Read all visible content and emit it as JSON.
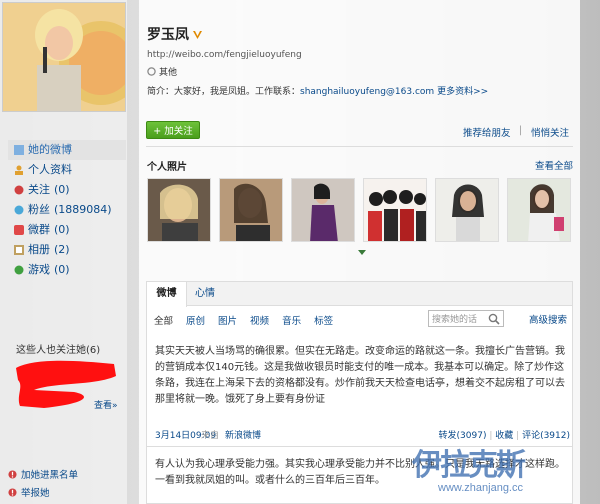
{
  "colors": {
    "link": "#0a4a8a",
    "follow_green": "#4a9e1c",
    "accent_orange": "#e08a00"
  },
  "sidebar": {
    "items": [
      {
        "label": "她的微博",
        "count": "",
        "icon": "home-icon",
        "active": true
      },
      {
        "label": "个人资料",
        "count": "",
        "icon": "profile-icon",
        "active": false
      },
      {
        "label": "关注",
        "count": "(0)",
        "icon": "follow-icon",
        "active": false
      },
      {
        "label": "粉丝",
        "count": "(1889084)",
        "icon": "fans-icon",
        "active": false
      },
      {
        "label": "微群",
        "count": "(0)",
        "icon": "group-icon",
        "active": false
      },
      {
        "label": "相册",
        "count": "(2)",
        "icon": "album-icon",
        "active": false
      },
      {
        "label": "游戏",
        "count": "(0)",
        "icon": "game-icon",
        "active": false
      }
    ],
    "also_follow_title": "这些人也关注她(6)",
    "see_all": "查看»",
    "blacklist": "加她进黑名单",
    "report": "举报她"
  },
  "profile": {
    "name": "罗玉凤",
    "url": "http://weibo.com/fengjieluoyufeng",
    "gender": "其他",
    "intro_prefix": "简介：大家好，我是凤姐。工作联系：",
    "email": "shanghailuoyufeng@163.com",
    "more": "更多资料>>",
    "follow_button": "+ 加关注",
    "rec_friends": "推荐给朋友",
    "separator": "|",
    "rec_follow": "悄悄关注"
  },
  "photos": {
    "title": "个人照片",
    "see_all": "查看全部"
  },
  "feed": {
    "tabs": [
      "微博",
      "心情"
    ],
    "filters": [
      "全部",
      "原创",
      "图片",
      "视频",
      "音乐",
      "标签"
    ],
    "search_placeholder": "搜索她的话",
    "advanced_search": "高级搜索",
    "post1_text": "其实天天被人当场骂的确很累。但实在无路走。改变命运的路就这一条。我擅长广告营销。我的营销成本仅140元钱。这是我做收银员时能支付的唯一成本。我基本可以确定。除了炒作这条路，我连在上海呆下去的资格都没有。炒作前我天天检查电话亭，想着交不起房租了可以去那里将就一晚。饿死了身上要有身份证",
    "post1_time": "3月14日09:09",
    "post1_from": "来自",
    "post1_via": "新浪微博",
    "post1_actions": [
      "转发(3097)",
      "收藏",
      "评论(3912)"
    ],
    "post2_text": "有人认为我心理承受能力强。其实我心理承受能力并不比别人强。只是我无路选择才这样跑。一看到我就凤姐的叫。或者什么的三百年后三百年。"
  },
  "watermark": {
    "text": "伊拉克斯",
    "url": "www.zhanjang.cc"
  }
}
